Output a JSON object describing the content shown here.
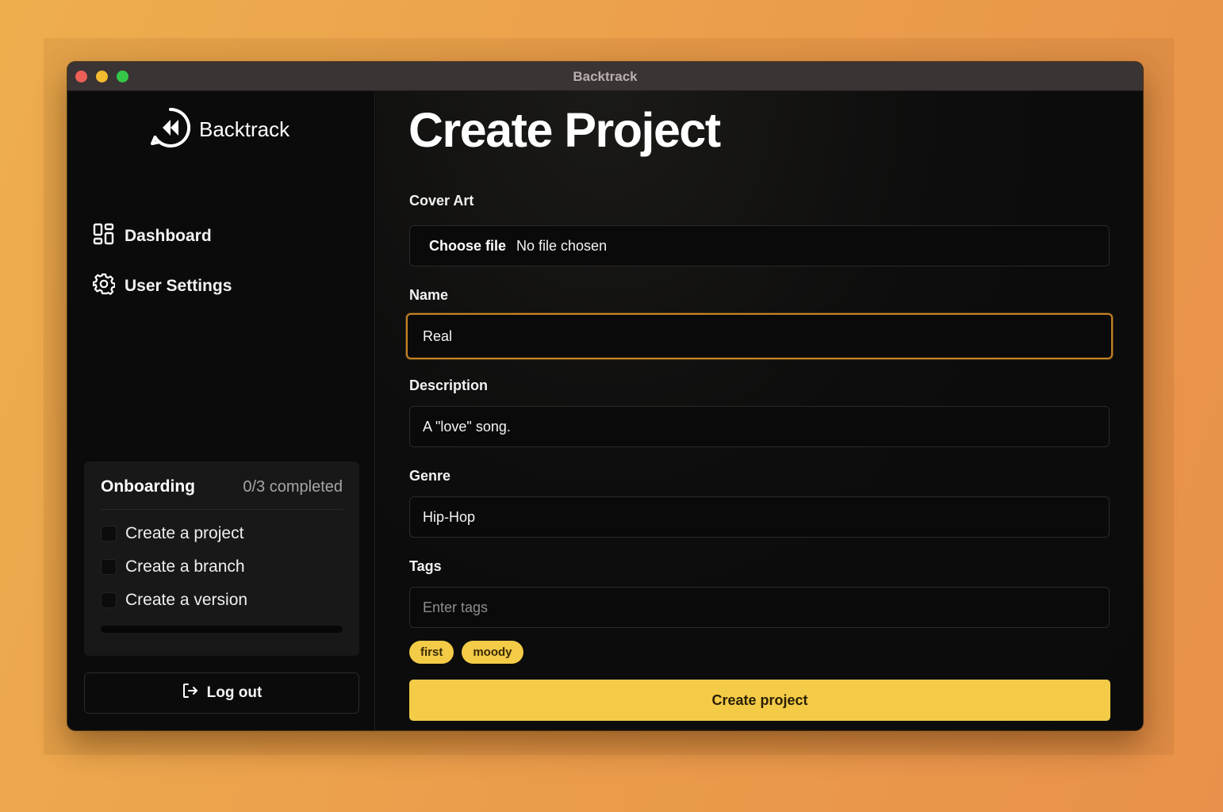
{
  "window": {
    "title": "Backtrack"
  },
  "sidebar": {
    "logo_text": "Backtrack",
    "nav": [
      {
        "label": "Dashboard",
        "icon": "dashboard-grid-icon"
      },
      {
        "label": "User Settings",
        "icon": "gear-icon"
      }
    ],
    "onboarding": {
      "title": "Onboarding",
      "count": "0/3 completed",
      "progress_fraction": 0,
      "tasks": [
        {
          "label": "Create a project",
          "checked": false
        },
        {
          "label": "Create a branch",
          "checked": false
        },
        {
          "label": "Create a version",
          "checked": false
        }
      ]
    },
    "logout_label": "Log out"
  },
  "main": {
    "title": "Create Project",
    "cover_art": {
      "label": "Cover Art",
      "button": "Choose file",
      "status": "No file chosen"
    },
    "name": {
      "label": "Name",
      "value": "Real"
    },
    "description": {
      "label": "Description",
      "value": "A \"love\" song."
    },
    "genre": {
      "label": "Genre",
      "value": "Hip-Hop"
    },
    "tags": {
      "label": "Tags",
      "placeholder": "Enter tags",
      "items": [
        "first",
        "moody"
      ]
    },
    "submit_label": "Create project"
  },
  "colors": {
    "accent": "#f3cb47",
    "focus_ring": "#c58423",
    "background": "#0b0b0b"
  }
}
